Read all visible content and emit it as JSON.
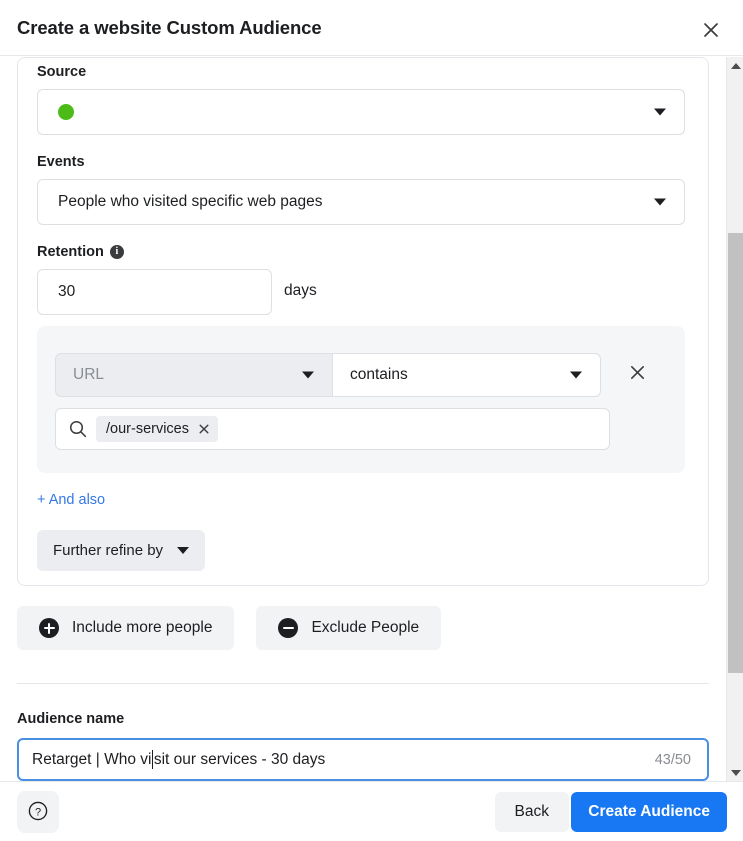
{
  "header": {
    "title": "Create a website Custom Audience",
    "close_icon": "close-icon"
  },
  "form": {
    "source": {
      "label": "Source",
      "value": "",
      "status_dot_color": "#4cbb17",
      "caret_icon": "chevron-down-icon"
    },
    "events": {
      "label": "Events",
      "value": "People who visited specific web pages",
      "caret_icon": "chevron-down-icon"
    },
    "retention": {
      "label": "Retention",
      "info_icon": "info-icon",
      "value": "30",
      "unit": "days"
    },
    "rule": {
      "field": {
        "value": "URL",
        "caret_icon": "chevron-down-icon"
      },
      "operator": {
        "value": "contains",
        "caret_icon": "chevron-down-icon"
      },
      "remove_icon": "close-icon",
      "value_field": {
        "search_icon": "search-icon",
        "placeholder": "",
        "tokens": [
          {
            "label": "/our-services",
            "remove_icon": "close-icon"
          }
        ]
      }
    },
    "and_also_label": "+ And also",
    "refine": {
      "label": "Further refine by",
      "caret_icon": "chevron-down-icon"
    }
  },
  "audience_actions": {
    "include": {
      "label": "Include more people",
      "icon": "plus-circle-icon"
    },
    "exclude": {
      "label": "Exclude People",
      "icon": "minus-circle-icon"
    }
  },
  "audience_name": {
    "label": "Audience name",
    "value_before_caret": "Retarget | Who vi",
    "value_after_caret": "sit our services - 30 days",
    "full_value": "Retarget | Who visit our services - 30 days",
    "char_count": "43/50"
  },
  "footer": {
    "help_icon": "question-circle-icon",
    "back_label": "Back",
    "create_label": "Create Audience"
  },
  "scrollbar": {
    "up_icon": "triangle-up-icon",
    "down_icon": "triangle-down-icon"
  },
  "colors": {
    "primary": "#1877f2",
    "link": "#3578e5",
    "status_green": "#4cbb17",
    "focus_border": "#4a90e2"
  }
}
